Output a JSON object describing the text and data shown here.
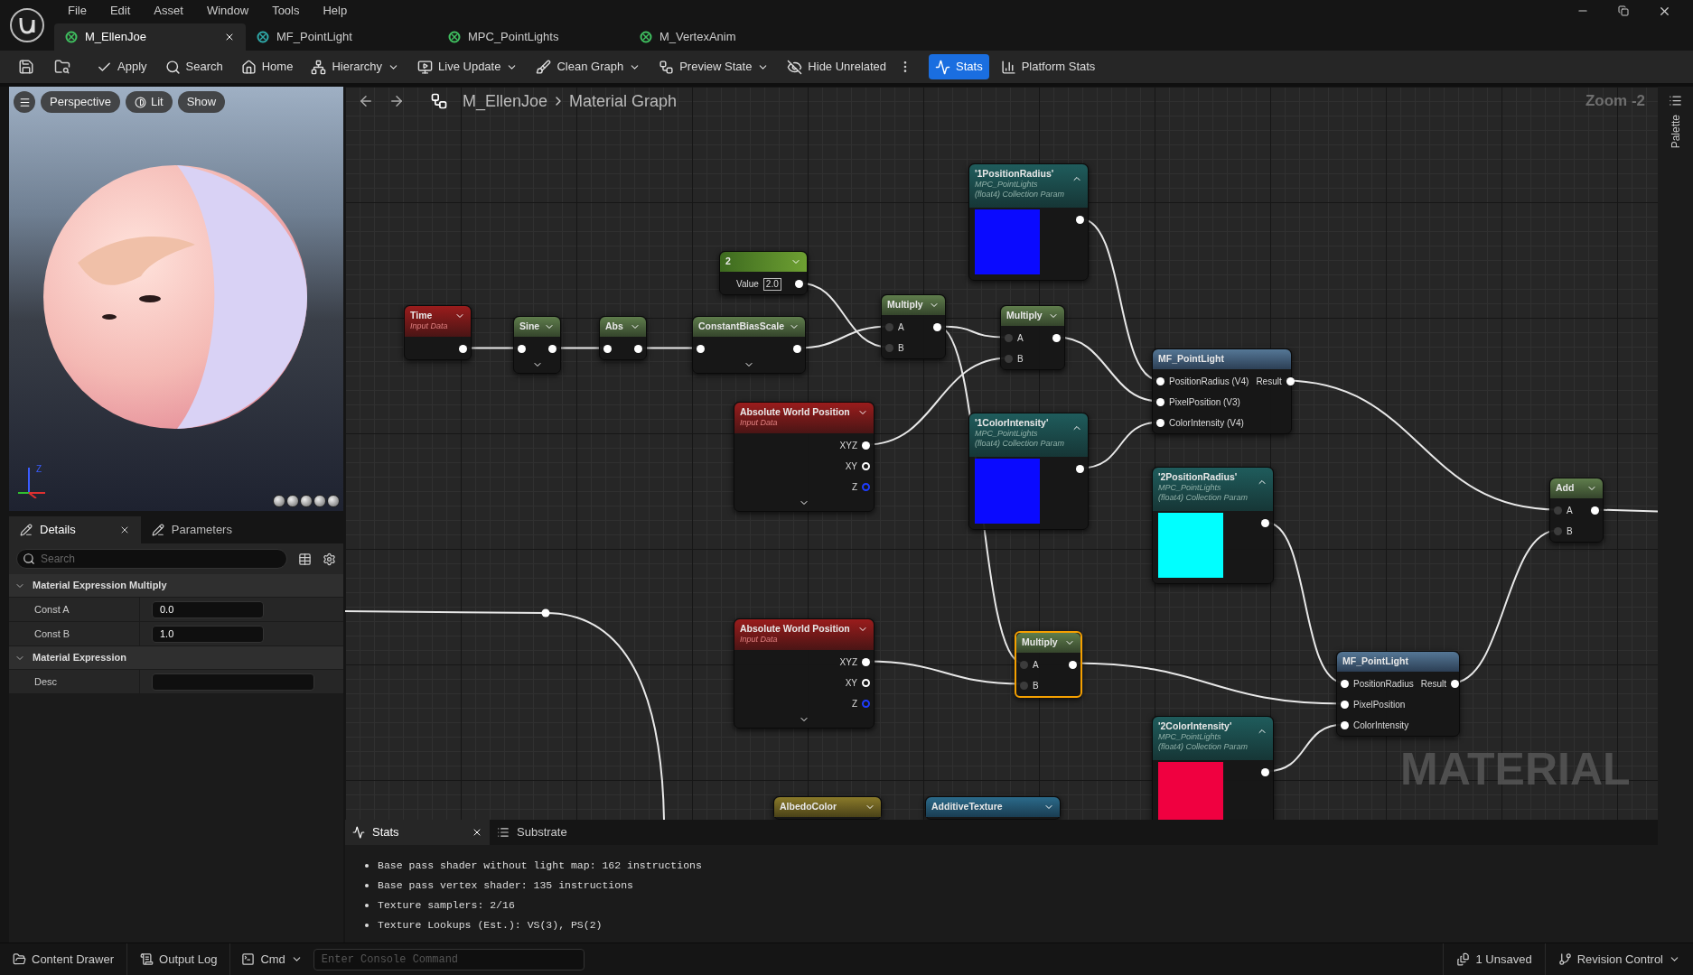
{
  "menu": [
    "File",
    "Edit",
    "Asset",
    "Window",
    "Tools",
    "Help"
  ],
  "tabs": [
    {
      "label": "M_EllenJoe",
      "selected": true,
      "closable": true
    },
    {
      "label": "MF_PointLight",
      "selected": false,
      "closable": false
    },
    {
      "label": "MPC_PointLights",
      "selected": false,
      "closable": false
    },
    {
      "label": "M_VertexAnim",
      "selected": false,
      "closable": false
    }
  ],
  "toolbar": [
    {
      "label": "Apply",
      "selected": false,
      "dropdown": false
    },
    {
      "label": "Search",
      "selected": false,
      "dropdown": false
    },
    {
      "label": "Home",
      "selected": false,
      "dropdown": false
    },
    {
      "label": "Hierarchy",
      "selected": false,
      "dropdown": true
    },
    {
      "label": "Live Update",
      "selected": false,
      "dropdown": true
    },
    {
      "label": "Clean Graph",
      "selected": false,
      "dropdown": true
    },
    {
      "label": "Preview State",
      "selected": false,
      "dropdown": true
    },
    {
      "label": "Hide Unrelated",
      "selected": false,
      "dropdown": false
    },
    {
      "label": "Stats",
      "selected": true,
      "dropdown": false
    },
    {
      "label": "Platform Stats",
      "selected": false,
      "dropdown": false
    }
  ],
  "viewport": {
    "buttons": [
      {
        "label": "Perspective"
      },
      {
        "label": "Lit"
      },
      {
        "label": "Show"
      }
    ],
    "axis_label": "Z"
  },
  "details": {
    "tabs": [
      {
        "label": "Details",
        "selected": true,
        "closable": true
      },
      {
        "label": "Parameters",
        "selected": false,
        "closable": false
      }
    ],
    "search": {
      "placeholder": "Search"
    },
    "sections": [
      {
        "title": "Material Expression Multiply",
        "expanded": true,
        "properties": [
          {
            "name": "Const A",
            "value": "0.0"
          },
          {
            "name": "Const B",
            "value": "1.0"
          }
        ]
      },
      {
        "title": "Material Expression",
        "expanded": true,
        "properties": [
          {
            "name": "Desc"
          }
        ]
      }
    ]
  },
  "graph": {
    "breadcrumb": [
      "M_EllenJoe",
      "Material Graph"
    ],
    "zoom": "Zoom -2",
    "label": "MATERIAL",
    "nodes": [
      {
        "kind": "param",
        "title": "'1PositionRadius'",
        "subtitle": [
          "MPC_PointLights",
          "(float4) Collection Param"
        ],
        "expanded": true,
        "color": "#0a0aff",
        "selected": false,
        "footer_caret": false,
        "rows": [
          {
            "out": {
              "kind": "solid"
            }
          }
        ]
      },
      {
        "kind": "constant",
        "title": "2",
        "dropdown": true,
        "selected": false,
        "footer_caret": false,
        "rows": [
          {
            "label": "Value",
            "field": "2.0",
            "out": {
              "kind": "solid"
            }
          }
        ]
      },
      {
        "kind": "input",
        "title": "Time",
        "subtitle": [
          "Input Data"
        ],
        "dropdown": true,
        "selected": false,
        "footer_caret": false,
        "rows": [
          {
            "out": {
              "kind": "solid"
            }
          }
        ]
      },
      {
        "kind": "math",
        "title": "Sine",
        "dropdown": true,
        "selected": false,
        "footer_caret": true,
        "rows": [
          {
            "in": {
              "kind": "solid"
            },
            "out": {
              "kind": "solid"
            }
          }
        ]
      },
      {
        "kind": "math",
        "title": "Abs",
        "dropdown": true,
        "selected": false,
        "footer_caret": false,
        "rows": [
          {
            "in": {
              "kind": "solid"
            },
            "out": {
              "kind": "solid"
            }
          }
        ]
      },
      {
        "kind": "math",
        "title": "ConstantBiasScale",
        "dropdown": true,
        "selected": false,
        "footer_caret": true,
        "rows": [
          {
            "in": {
              "kind": "solid"
            },
            "out": {
              "kind": "solid"
            }
          }
        ]
      },
      {
        "kind": "math",
        "title": "Multiply",
        "dropdown": true,
        "selected": false,
        "footer_caret": false,
        "rows": [
          {
            "in": {
              "kind": "dim",
              "label": "A"
            },
            "out": {
              "kind": "solid"
            }
          },
          {
            "in": {
              "kind": "dim",
              "label": "B"
            }
          }
        ]
      },
      {
        "kind": "math",
        "title": "Multiply",
        "dropdown": true,
        "selected": false,
        "footer_caret": false,
        "rows": [
          {
            "in": {
              "kind": "dim",
              "label": "A"
            },
            "out": {
              "kind": "solid"
            }
          },
          {
            "in": {
              "kind": "dim",
              "label": "B"
            }
          }
        ]
      },
      {
        "kind": "function",
        "title": "MF_PointLight",
        "selected": false,
        "footer_caret": false,
        "rows": [
          {
            "in": {
              "kind": "solid",
              "label": "PositionRadius (V4)"
            },
            "out": {
              "kind": "solid",
              "label": "Result"
            }
          },
          {
            "in": {
              "kind": "solid",
              "label": "PixelPosition (V3)"
            }
          },
          {
            "in": {
              "kind": "solid",
              "label": "ColorIntensity (V4)"
            }
          }
        ]
      },
      {
        "kind": "input",
        "title": "Absolute World Position",
        "subtitle": [
          "Input Data"
        ],
        "dropdown": true,
        "selected": false,
        "footer_caret": true,
        "rows": [
          {
            "out": {
              "kind": "solid",
              "label": "XYZ"
            }
          },
          {
            "out": {
              "kind": "ring",
              "label": "XY"
            }
          },
          {
            "out": {
              "kind": "blue-ring",
              "label": "Z"
            }
          }
        ]
      },
      {
        "kind": "param",
        "title": "'1ColorIntensity'",
        "subtitle": [
          "MPC_PointLights",
          "(float4) Collection Param"
        ],
        "expanded": true,
        "color": "#0a0aff",
        "selected": false,
        "footer_caret": false,
        "rows": [
          {
            "out": {
              "kind": "solid"
            }
          }
        ]
      },
      {
        "kind": "param",
        "title": "'2PositionRadius'",
        "subtitle": [
          "MPC_PointLights",
          "(float4) Collection Param"
        ],
        "expanded": true,
        "color": "#00ffff",
        "selected": false,
        "footer_caret": false,
        "rows": [
          {
            "out": {
              "kind": "solid"
            }
          }
        ]
      },
      {
        "kind": "math",
        "title": "Add",
        "dropdown": true,
        "selected": false,
        "footer_caret": false,
        "rows": [
          {
            "in": {
              "kind": "dim",
              "label": "A"
            },
            "out": {
              "kind": "solid"
            }
          },
          {
            "in": {
              "kind": "dim",
              "label": "B"
            }
          }
        ]
      },
      {
        "kind": "input",
        "title": "Absolute World Position",
        "subtitle": [
          "Input Data"
        ],
        "dropdown": true,
        "selected": false,
        "footer_caret": true,
        "rows": [
          {
            "out": {
              "kind": "solid",
              "label": "XYZ"
            }
          },
          {
            "out": {
              "kind": "ring",
              "label": "XY"
            }
          },
          {
            "out": {
              "kind": "blue-ring",
              "label": "Z"
            }
          }
        ]
      },
      {
        "kind": "math",
        "title": "Multiply",
        "dropdown": true,
        "selected": true,
        "footer_caret": false,
        "rows": [
          {
            "in": {
              "kind": "dim",
              "label": "A"
            },
            "out": {
              "kind": "solid"
            }
          },
          {
            "in": {
              "kind": "dim",
              "label": "B"
            }
          }
        ]
      },
      {
        "kind": "function",
        "title": "MF_PointLight",
        "selected": false,
        "footer_caret": false,
        "rows": [
          {
            "in": {
              "kind": "solid",
              "label": "PositionRadius"
            },
            "out": {
              "kind": "solid",
              "label": "Result"
            }
          },
          {
            "in": {
              "kind": "solid",
              "label": "PixelPosition"
            }
          },
          {
            "in": {
              "kind": "solid",
              "label": "ColorIntensity"
            }
          }
        ]
      },
      {
        "kind": "param",
        "title": "'2ColorIntensity'",
        "subtitle": [
          "MPC_PointLights",
          "(float4) Collection Param"
        ],
        "expanded": true,
        "color": "#f00040",
        "selected": false,
        "footer_caret": false,
        "rows": [
          {
            "out": {
              "kind": "solid"
            }
          }
        ]
      },
      {
        "kind": "vector",
        "title": "AlbedoColor",
        "dropdown": true,
        "selected": false,
        "footer_caret": false
      },
      {
        "kind": "texture",
        "title": "AdditiveTexture",
        "dropdown": true,
        "selected": false,
        "footer_caret": false
      }
    ]
  },
  "palette": {
    "label": "Palette"
  },
  "stats": {
    "tabs": [
      {
        "label": "Stats",
        "selected": true,
        "closable": true
      },
      {
        "label": "Substrate",
        "selected": false,
        "closable": false
      }
    ],
    "lines": [
      "Base pass shader without light map: 162 instructions",
      "Base pass vertex shader: 135 instructions",
      "Texture samplers: 2/16",
      "Texture Lookups (Est.): VS(3), PS(2)"
    ]
  },
  "status_bar": {
    "buttons": [
      {
        "label": "Content Drawer"
      },
      {
        "label": "Output Log"
      }
    ],
    "cmd": "Cmd",
    "console": {
      "placeholder": "Enter Console Command"
    },
    "unsaved": "1 Unsaved",
    "revision": "Revision Control"
  }
}
